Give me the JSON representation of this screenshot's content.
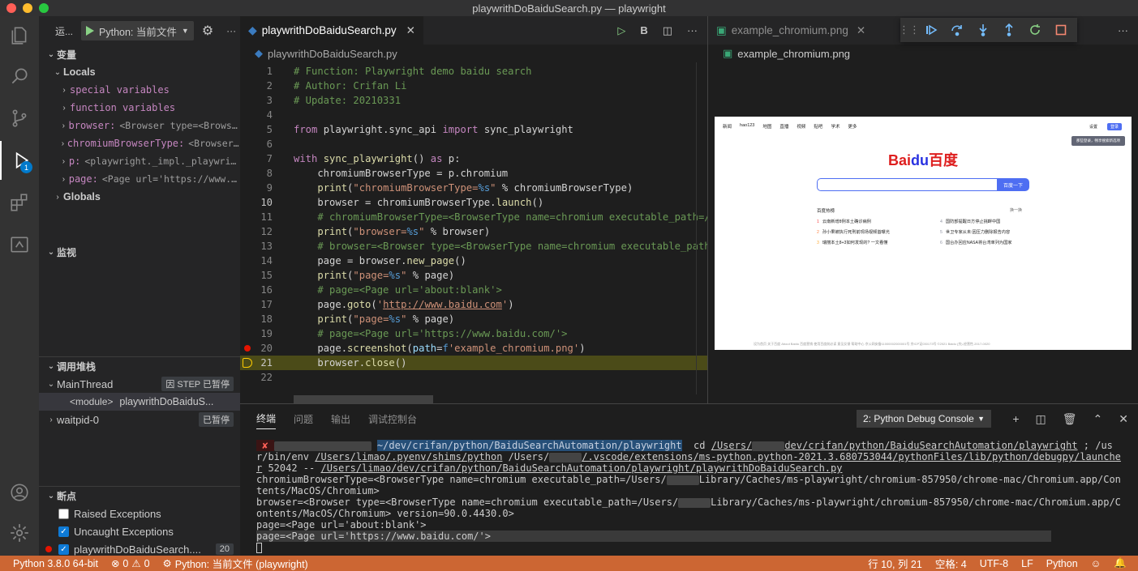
{
  "window": {
    "title": "playwrithDoBaiduSearch.py — playwright"
  },
  "sidebar": {
    "run_title": "运...",
    "run_config": "Python: 当前文件",
    "variables_header": "变量",
    "locals_label": "Locals",
    "locals": [
      {
        "name": "special variables",
        "value": ""
      },
      {
        "name": "function variables",
        "value": ""
      },
      {
        "name": "browser:",
        "value": "<Browser type=<Browse..."
      },
      {
        "name": "chromiumBrowserType:",
        "value": "<BrowserT..."
      },
      {
        "name": "p:",
        "value": "<playwright._impl._playwrig..."
      },
      {
        "name": "page:",
        "value": "<Page url='https://www.b..."
      }
    ],
    "globals_label": "Globals",
    "watch_header": "监视",
    "callstack_header": "调用堆栈",
    "threads": [
      {
        "name": "MainThread",
        "status": "因 STEP 已暂停"
      },
      {
        "name": "waitpid-0",
        "status": "已暂停"
      }
    ],
    "frame": {
      "name": "<module>",
      "file": "playwrithDoBaiduS..."
    },
    "breakpoints_header": "断点",
    "breakpoints": [
      {
        "label": "Raised Exceptions",
        "checked": false
      },
      {
        "label": "Uncaught Exceptions",
        "checked": true
      },
      {
        "label": "playwrithDoBaiduSearch....",
        "checked": true,
        "line": "20"
      }
    ]
  },
  "activity": {
    "debug_badge": "1"
  },
  "editor": {
    "tab_label": "playwrithDoBaiduSearch.py",
    "breadcrumb": "playwrithDoBaiduSearch.py",
    "run_label": "B",
    "current_line": 21,
    "breakpoint_line": 20,
    "lines": [
      {
        "n": "1",
        "code": "# Function: Playwright demo baidu search"
      },
      {
        "n": "2",
        "code": "# Author: Crifan Li"
      },
      {
        "n": "3",
        "code": "# Update: 20210331"
      },
      {
        "n": "4",
        "code": ""
      },
      {
        "n": "5",
        "code": "from playwright.sync_api import sync_playwright"
      },
      {
        "n": "6",
        "code": ""
      },
      {
        "n": "7",
        "code": "with sync_playwright() as p:"
      },
      {
        "n": "8",
        "code": "    chromiumBrowserType = p.chromium"
      },
      {
        "n": "9",
        "code": "    print(\"chromiumBrowserType=%s\" % chromiumBrowserType)"
      },
      {
        "n": "10",
        "code": "    browser = chromiumBrowserType.launch()"
      },
      {
        "n": "11",
        "code": "    # chromiumBrowserType=<BrowserType name=chromium executable_path=/U"
      },
      {
        "n": "12",
        "code": "    print(\"browser=%s\" % browser)"
      },
      {
        "n": "13",
        "code": "    # browser=<Browser type=<BrowserType name=chromium executable_path="
      },
      {
        "n": "14",
        "code": "    page = browser.new_page()"
      },
      {
        "n": "15",
        "code": "    print(\"page=%s\" % page)"
      },
      {
        "n": "16",
        "code": "    # page=<Page url='about:blank'>"
      },
      {
        "n": "17",
        "code": "    page.goto('http://www.baidu.com')"
      },
      {
        "n": "18",
        "code": "    print(\"page=%s\" % page)"
      },
      {
        "n": "19",
        "code": "    # page=<Page url='https://www.baidu.com/'>"
      },
      {
        "n": "20",
        "code": "    page.screenshot(path=f'example_chromium.png')"
      },
      {
        "n": "21",
        "code": "    browser.close()"
      },
      {
        "n": "22",
        "code": ""
      }
    ]
  },
  "image_editor": {
    "tab_label": "example_chromium.png",
    "breadcrumb": "example_chromium.png"
  },
  "baidu": {
    "nav": [
      "新闻",
      "hao123",
      "地图",
      "直播",
      "视频",
      "贴吧",
      "学术",
      "更多"
    ],
    "logo": "Bai百度",
    "logo_paw": "du",
    "search_button": "百度一下",
    "settings": "设置",
    "login": "登录",
    "tooltip": "那些登录，畅享搜索新选项",
    "hot_title": "百度热榜",
    "refresh": "换一换",
    "hot_left": [
      {
        "rank": "1",
        "text": "云南新增8例本土确诊病例"
      },
      {
        "rank": "2",
        "text": "孙小果被执行死刑前现场视频首曝光"
      },
      {
        "rank": "3",
        "text": "瑞丽本土8+3如何发现的? 一文看懂"
      }
    ],
    "hot_right": [
      {
        "rank": "4",
        "text": "国防部提醒日方停止挑衅中国"
      },
      {
        "rank": "5",
        "text": "世卫专家从未:因压力删除报告内容"
      },
      {
        "rank": "6",
        "text": "国台办回应NASA将台湾单列为国家"
      }
    ],
    "footer": "设为首页   关于百度   About Baidu   百度营销   使用百度前必读   意见反馈   帮助中心   京公网安备11000002000001号   京ICP证030173号   ©2021 Baidu   (京)-经营性-2017-0020"
  },
  "panel": {
    "tabs": [
      "终端",
      "问题",
      "输出",
      "调试控制台"
    ],
    "active_tab": "终端",
    "terminal_select": "2: Python Debug Console",
    "terminal": {
      "prompt_path": "~/dev/crifan/python/BaiduSearchAutomation/playwright",
      "cmd_a": "  cd ",
      "cmd_b": "/Users/",
      "cmd_c": "dev/crifan/python/BaiduSearchAutomation/playwright",
      "cmd_d": " ; /usr/bin/env ",
      "cmd_e": "/Users/limao/.pyenv/shims/python",
      "cmd_f": " /Users/",
      "cmd_g": "/.vscode/extensions/ms-python.python-2021.3.680753044/pythonFiles/lib/python/debugpy/launcher",
      "cmd_h": " 52042 -- ",
      "cmd_i": "/Users/limao/dev/crifan/python/BaiduSearchAutomation/playwright/playwrithDoBaiduSearch.py",
      "out1a": "chromiumBrowserType=<BrowserType name=chromium executable_path=/Users/",
      "out1b": "Library/Caches/ms-playwright/chromium-857950/chrome-mac/Chromium.app/Contents/MacOS/Chromium>",
      "out2a": "browser=<Browser type=<BrowserType name=chromium executable_path=/Users/",
      "out2b": "Library/Caches/ms-playwright/chromium-857950/chrome-mac/Chromium.app/Contents/MacOS/Chromium> version=90.0.4430.0>",
      "out3": "page=<Page url='about:blank'>",
      "out4": "page=<Page url='https://www.baidu.com/'>"
    }
  },
  "statusbar": {
    "python": "Python 3.8.0 64-bit",
    "errors": "0",
    "warnings": "0",
    "debug_config": "Python: 当前文件 (playwright)",
    "position": "行 10, 列 21",
    "spaces": "空格: 4",
    "encoding": "UTF-8",
    "eol": "LF",
    "language": "Python"
  }
}
